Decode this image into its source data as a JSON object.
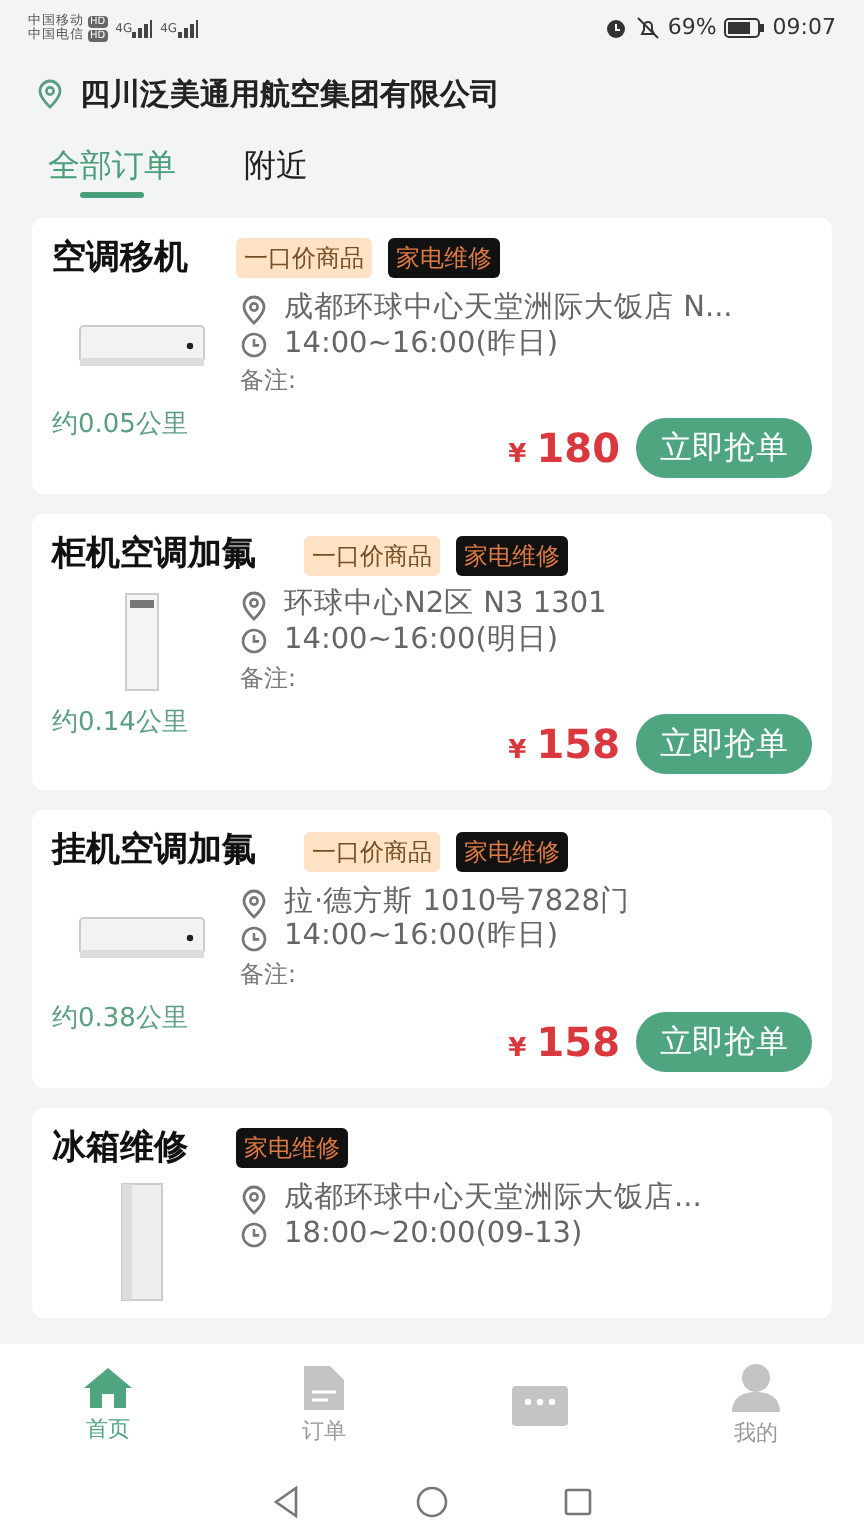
{
  "status_bar": {
    "carriers": [
      "中国移动",
      "中国电信"
    ],
    "carrier_badges": [
      "HD",
      "HD"
    ],
    "networks": [
      "4G",
      "4G"
    ],
    "battery": "69%",
    "time": "09:07"
  },
  "header": {
    "company": "四川泛美通用航空集团有限公司"
  },
  "tabs": [
    {
      "label": "全部订单",
      "selected": true
    },
    {
      "label": "附近",
      "selected": false
    }
  ],
  "orders": [
    {
      "title": "空调移机",
      "tags": [
        {
          "label": "一口价商品",
          "kind": "fixed"
        },
        {
          "label": "家电维修",
          "kind": "category"
        }
      ],
      "kind": "wall-ac",
      "address": "成都环球中心天堂洲际大饭店 N...",
      "time": "14:00~16:00(昨日)",
      "note": "备注:",
      "distance": "约0.05公里",
      "currency": "¥",
      "price": "180",
      "action": "立即抢单"
    },
    {
      "title": "柜机空调加氟",
      "tags": [
        {
          "label": "一口价商品",
          "kind": "fixed"
        },
        {
          "label": "家电维修",
          "kind": "category"
        }
      ],
      "kind": "floor-ac",
      "address": "环球中心N2区 N3 1301",
      "time": "14:00~16:00(明日)",
      "note": "备注:",
      "distance": "约0.14公里",
      "currency": "¥",
      "price": "158",
      "action": "立即抢单"
    },
    {
      "title": "挂机空调加氟",
      "tags": [
        {
          "label": "一口价商品",
          "kind": "fixed"
        },
        {
          "label": "家电维修",
          "kind": "category"
        }
      ],
      "kind": "wall-ac",
      "address": "拉·德方斯 1010号7828门",
      "time": "14:00~16:00(昨日)",
      "note": "备注:",
      "distance": "约0.38公里",
      "currency": "¥",
      "price": "158",
      "action": "立即抢单"
    },
    {
      "title": "冰箱维修",
      "tags": [
        {
          "label": "家电维修",
          "kind": "category"
        }
      ],
      "kind": "fridge",
      "address": "成都环球中心天堂洲际大饭店...",
      "time": "18:00~20:00(09-13)"
    }
  ],
  "bottom_nav": [
    {
      "label": "首页",
      "kind": "home",
      "selected": true
    },
    {
      "label": "订单",
      "kind": "document",
      "selected": false
    },
    {
      "kind": "chat",
      "selected": false
    },
    {
      "label": "我的",
      "kind": "person",
      "selected": false
    }
  ]
}
